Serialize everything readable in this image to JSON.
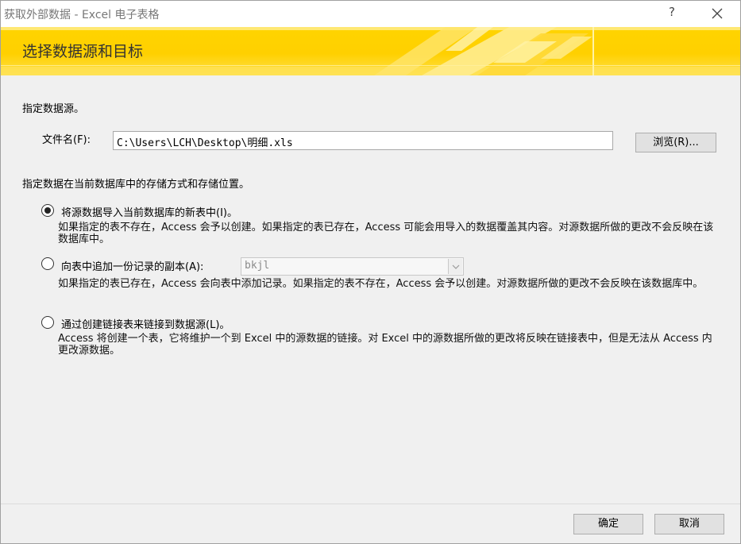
{
  "window": {
    "title": "获取外部数据 - Excel 电子表格",
    "help_label": "?",
    "close_icon": "close-icon"
  },
  "banner": {
    "heading": "选择数据源和目标"
  },
  "source": {
    "heading": "指定数据源。",
    "filename_label": "文件名(F):",
    "filename_value": "C:\\Users\\LCH\\Desktop\\明细.xls",
    "browse_label": "浏览(R)..."
  },
  "storage": {
    "heading": "指定数据在当前数据库中的存储方式和存储位置。",
    "options": [
      {
        "label": "将源数据导入当前数据库的新表中(I)。",
        "description": "如果指定的表不存在，Access 会予以创建。如果指定的表已存在，Access 可能会用导入的数据覆盖其内容。对源数据所做的更改不会反映在该数据库中。",
        "selected": true
      },
      {
        "label": "向表中追加一份记录的副本(A):",
        "description": "如果指定的表已存在，Access 会向表中添加记录。如果指定的表不存在，Access 会予以创建。对源数据所做的更改不会反映在该数据库中。",
        "selected": false,
        "table_value": "bkjl"
      },
      {
        "label": "通过创建链接表来链接到数据源(L)。",
        "description": "Access 将创建一个表，它将维护一个到 Excel 中的源数据的链接。对 Excel 中的源数据所做的更改将反映在链接表中，但是无法从 Access 内更改源数据。",
        "selected": false
      }
    ]
  },
  "footer": {
    "ok_label": "确定",
    "cancel_label": "取消"
  }
}
